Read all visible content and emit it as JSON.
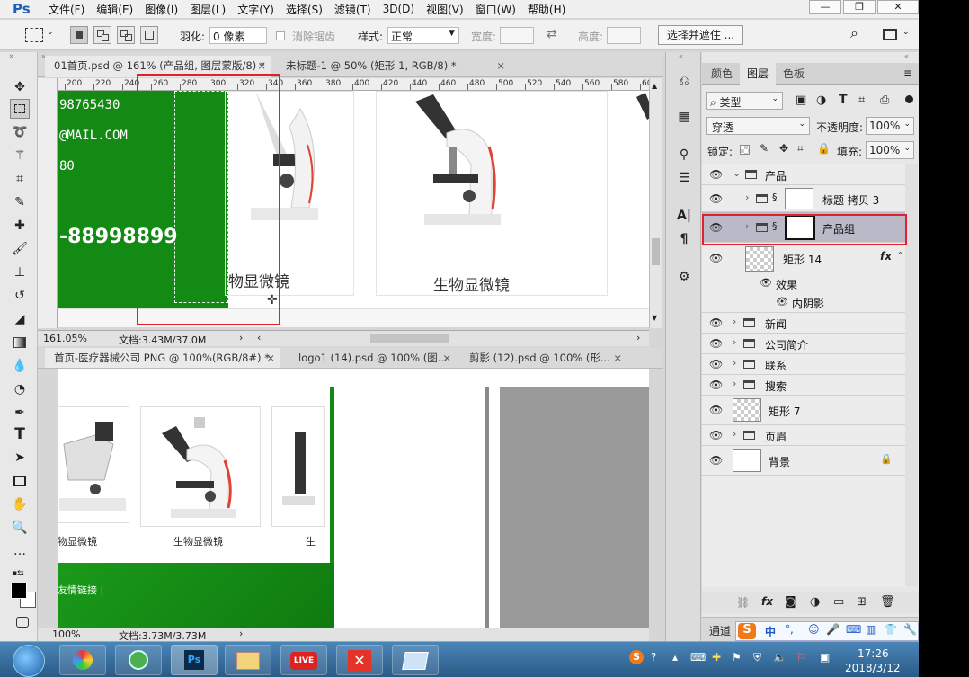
{
  "app": {
    "logo": "Ps"
  },
  "menu": [
    "文件(F)",
    "编辑(E)",
    "图像(I)",
    "图层(L)",
    "文字(Y)",
    "选择(S)",
    "滤镜(T)",
    "3D(D)",
    "视图(V)",
    "窗口(W)",
    "帮助(H)"
  ],
  "window_controls": {
    "minimize": "—",
    "restore": "❐",
    "close": "✕"
  },
  "options": {
    "feather_label": "羽化:",
    "feather_value": "0 像素",
    "antialias_label": "消除锯齿",
    "style_label": "样式:",
    "style_value": "正常",
    "width_label": "宽度:",
    "height_label": "高度:",
    "select_mask_button": "选择并遮住 ..."
  },
  "doc_top": {
    "tabs": [
      {
        "label": "01首页.psd @ 161% (产品组, 图层蒙版/8) *",
        "close": "×"
      },
      {
        "label": "未标题-1 @ 50% (矩形 1, RGB/8) *",
        "close": "×"
      }
    ],
    "ruler_ticks": [
      "200",
      "220",
      "240",
      "260",
      "280",
      "300",
      "320",
      "340",
      "360",
      "380",
      "400",
      "420",
      "440",
      "460",
      "480",
      "500",
      "520",
      "540",
      "560",
      "580",
      "600"
    ],
    "canvas_texts": {
      "line1": "98765430",
      "line2": "@MAIL.COM",
      "line3": "80",
      "phone": "-88998899"
    },
    "product_labels": [
      "物显微镜",
      "生物显微镜"
    ],
    "zoom": "161.05%",
    "doc_info": "文档:3.43M/37.0M"
  },
  "doc_bottom": {
    "tabs": [
      {
        "label": "首页-医疗器械公司 PNG @ 100%(RGB/8#) *",
        "close": "×"
      },
      {
        "label": "logo1 (14).psd @ 100% (图...",
        "close": "×"
      },
      {
        "label": "剪影 (12).psd @ 100% (形...",
        "close": "×"
      }
    ],
    "product_labels": [
      "物显微镜",
      "生物显微镜",
      "生"
    ],
    "footer_text": "友情链接 |",
    "zoom": "100%",
    "doc_info": "文档:3.73M/3.73M"
  },
  "panel": {
    "tabs": [
      "颜色",
      "图层",
      "色板"
    ],
    "filter_label": "类型",
    "blend_mode": "穿透",
    "opacity_label": "不透明度:",
    "opacity_value": "100%",
    "lock_label": "锁定:",
    "fill_label": "填充:",
    "fill_value": "100%",
    "layers": [
      {
        "name": "产品",
        "type": "group",
        "expanded": true
      },
      {
        "name": "标题 拷贝 3",
        "type": "group"
      },
      {
        "name": "产品组",
        "type": "group",
        "selected": true
      },
      {
        "name": "矩形 14",
        "type": "shape",
        "fx": "fx"
      },
      {
        "name": "效果",
        "type": "effects"
      },
      {
        "name": "内阴影",
        "type": "effect"
      },
      {
        "name": "新闻",
        "type": "group"
      },
      {
        "name": "公司简介",
        "type": "group"
      },
      {
        "name": "联系",
        "type": "group"
      },
      {
        "name": "搜索",
        "type": "group"
      },
      {
        "name": "矩形 7",
        "type": "shape"
      },
      {
        "name": "页眉",
        "type": "group"
      },
      {
        "name": "背景",
        "type": "background",
        "locked": true
      }
    ],
    "channel_label": "通道"
  },
  "taskbar": {
    "time": "17:26",
    "date": "2018/3/12",
    "ime": "中",
    "live_label": "LIVE"
  },
  "colors": {
    "green": "#138a13",
    "highlight": "#e0202a",
    "selected_layer": "#b9b9c7"
  }
}
